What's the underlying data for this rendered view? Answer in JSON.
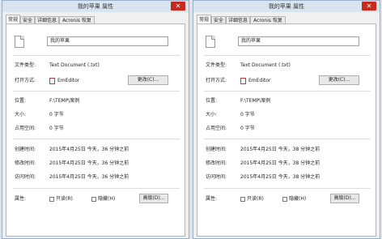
{
  "windows": [
    {
      "title": "我的苹果 属性",
      "close_glyph": "✕",
      "tabs": [
        "常规",
        "安全",
        "详细信息",
        "Acronis 恢复"
      ],
      "file_name": "我的苹果",
      "type_label": "文件类型:",
      "type_value": "Text Document (.txt)",
      "open_label": "打开方式:",
      "open_value": "EmEditor",
      "change_button": "更改(C)...",
      "location_label": "位置:",
      "location_value": "F:\\TEMP\\案例",
      "size_label": "大小:",
      "size_value": "0 字节",
      "disk_label": "占用空间:",
      "disk_value": "0 字节",
      "created_label": "创建时间:",
      "created_value": "2015年4月25日 今天，36 分钟之前",
      "modified_label": "修改时间:",
      "modified_value": "2015年4月25日 今天，36 分钟之前",
      "accessed_label": "访问时间:",
      "accessed_value": "2015年4月25日 今天，36 分钟之前",
      "attr_label": "属性:",
      "readonly_label": "只读(R)",
      "hidden_label": "隐藏(H)",
      "advanced_button": "高级(D)..."
    },
    {
      "title": "我的苹果 属性",
      "close_glyph": "✕",
      "tabs": [
        "常规",
        "安全",
        "详细信息",
        "Acronis 恢复"
      ],
      "file_name": "我的苹果",
      "type_label": "文件类型:",
      "type_value": "Text Document (.txt)",
      "open_label": "打开方式:",
      "open_value": "EmEditor",
      "change_button": "更改(C)...",
      "location_label": "位置:",
      "location_value": "F:\\TEMP\\案例",
      "size_label": "大小:",
      "size_value": "0 字节",
      "disk_label": "占用空间:",
      "disk_value": "0 字节",
      "created_label": "创建时间:",
      "created_value": "2015年4月25日 今天，38 分钟之前",
      "modified_label": "修改时间:",
      "modified_value": "2015年4月25日 今天，38 分钟之前",
      "accessed_label": "访问时间:",
      "accessed_value": "2015年4月25日 今天，38 分钟之前",
      "attr_label": "属性:",
      "readonly_label": "只读(R)",
      "hidden_label": "隐藏(H)",
      "advanced_button": "高级(D)..."
    }
  ]
}
